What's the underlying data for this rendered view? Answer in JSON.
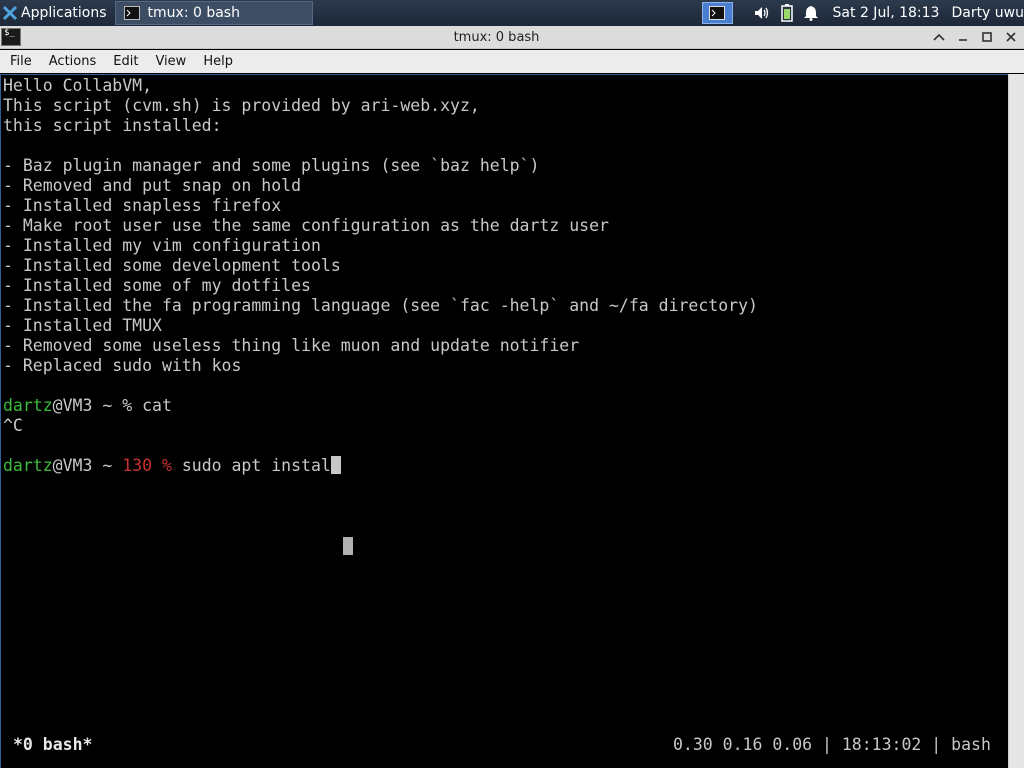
{
  "panel": {
    "apps_label": "Applications",
    "task_title": "tmux: 0 bash",
    "clock": "Sat  2 Jul, 18:13",
    "user": "Darty uwu"
  },
  "window": {
    "title": "tmux: 0 bash"
  },
  "menu": [
    "File",
    "Actions",
    "Edit",
    "View",
    "Help"
  ],
  "terminal": {
    "lines": [
      "Hello CollabVM,",
      "This script (cvm.sh) is provided by ari-web.xyz,",
      "this script installed:",
      "",
      "- Baz plugin manager and some plugins (see `baz help`)",
      "- Removed and put snap on hold",
      "- Installed snapless firefox",
      "- Make root user use the same configuration as the dartz user",
      "- Installed my vim configuration",
      "- Installed some development tools",
      "- Installed some of my dotfiles",
      "- Installed the fa programming language (see `fac -help` and ~/fa directory)",
      "- Installed TMUX",
      "- Removed some useless thing like muon and update notifier",
      "- Replaced sudo with kos"
    ],
    "prompt1": {
      "user": "dartz",
      "host": "@VM3 ~ ",
      "sym": "% ",
      "cmd": "cat"
    },
    "interrupt": "^C",
    "prompt2": {
      "user": "dartz",
      "host": "@VM3 ~ ",
      "code": "130 % ",
      "cmd": "sudo apt instal"
    },
    "status_left": "*0 bash*",
    "status_right": "0.30 0.16 0.06 | 18:13:02 | bash"
  }
}
